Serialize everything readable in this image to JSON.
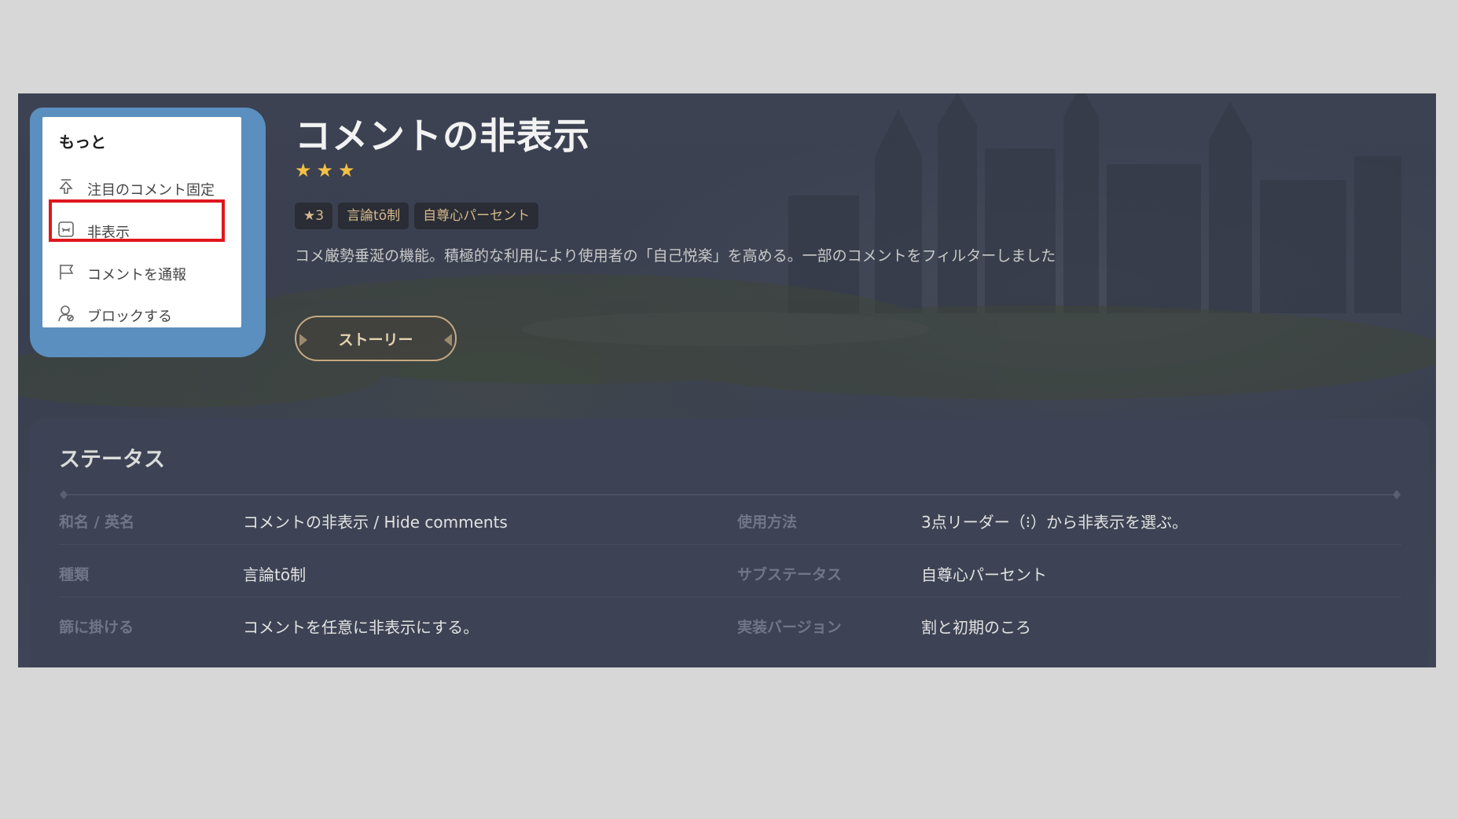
{
  "menu": {
    "title": "もっと",
    "items": [
      {
        "label": "注目のコメント固定",
        "icon": "pin-icon"
      },
      {
        "label": "非表示",
        "icon": "hide-icon"
      },
      {
        "label": "コメントを通報",
        "icon": "flag-icon"
      },
      {
        "label": "ブロックする",
        "icon": "block-user-icon"
      }
    ]
  },
  "header": {
    "title": "コメントの非表示",
    "rating": 3,
    "tags": [
      "★3",
      "言論tō制",
      "自尊心パーセント"
    ],
    "description": "コメ厳勢垂涎の機能。積極的な利用により使用者の「自己悦楽」を高める。一部のコメントをフィルターしました",
    "story_button": "ストーリー"
  },
  "status": {
    "title": "ステータス",
    "rows": [
      {
        "label_left": "和名 / 英名",
        "value_left": "コメントの非表示 / Hide comments",
        "label_right": "使用方法",
        "value_right": "3点リーダー（⁝）から非表示を選ぶ。"
      },
      {
        "label_left": "種類",
        "value_left": "言論tō制",
        "label_right": "サブステータス",
        "value_right": "自尊心パーセント"
      },
      {
        "label_left": "篩に掛ける",
        "value_left": "コメントを任意に非表示にする。",
        "label_right": "実装バージョン",
        "value_right": "割と初期のころ"
      }
    ]
  },
  "colors": {
    "accent_star": "#f5c043",
    "highlight": "#e0161d",
    "menu_frame": "#5b8fbf"
  }
}
